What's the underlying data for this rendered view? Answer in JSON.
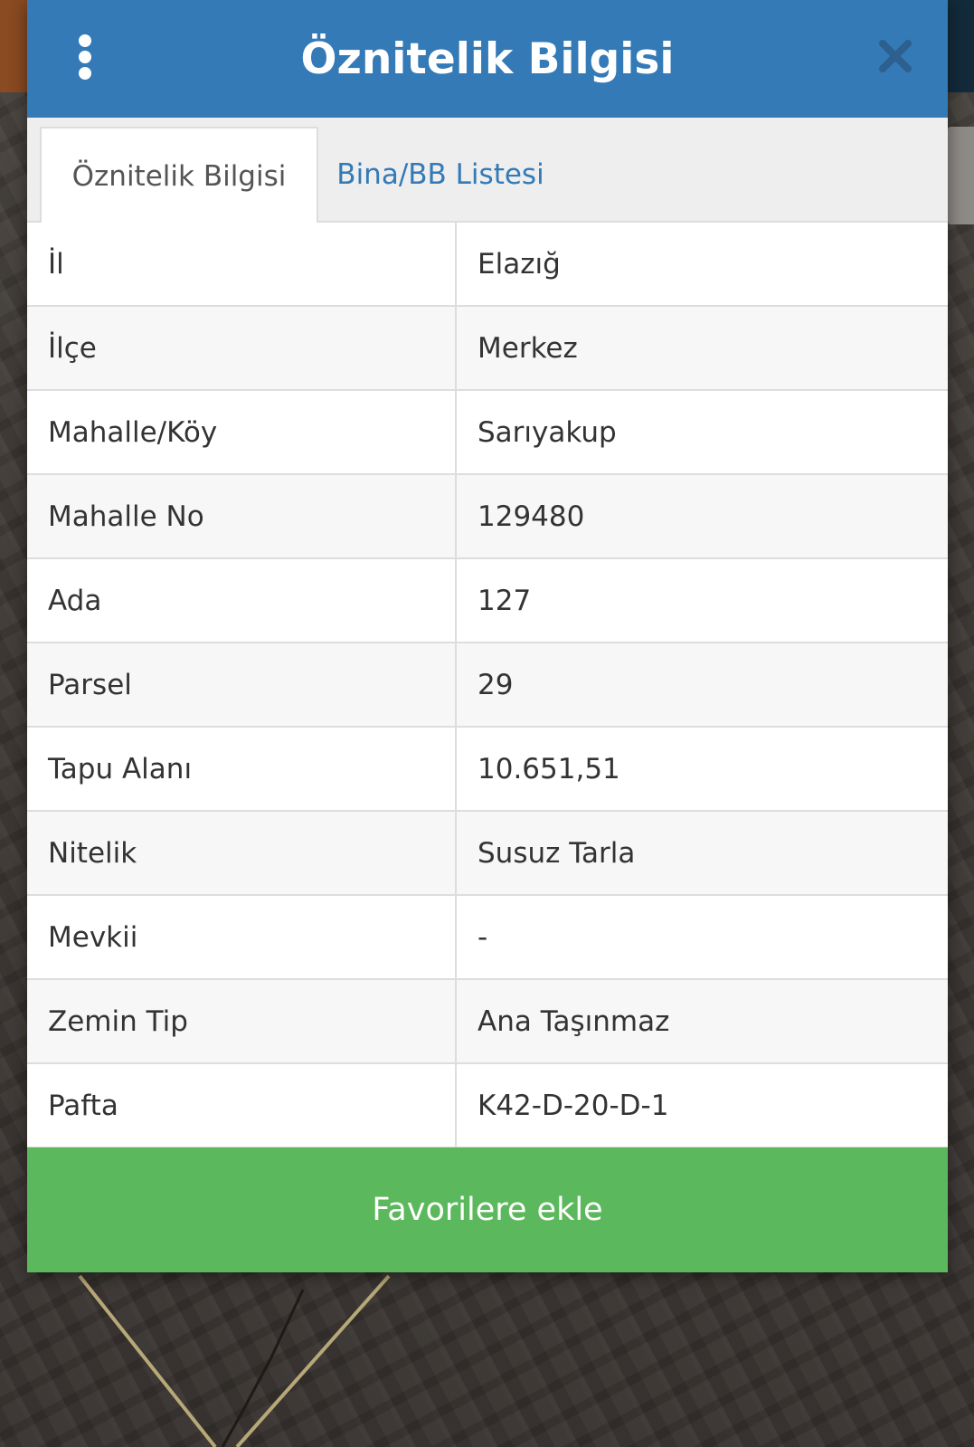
{
  "dialog": {
    "title": "Öznitelik Bilgisi",
    "menu_icon": "kebab-menu-icon",
    "close_icon": "close-icon",
    "header_color": "#337ab7"
  },
  "tabs": [
    {
      "label": "Öznitelik Bilgisi",
      "active": true
    },
    {
      "label": "Bina/BB Listesi",
      "active": false
    }
  ],
  "attributes": [
    {
      "label": "İl",
      "value": "Elazığ"
    },
    {
      "label": "İlçe",
      "value": "Merkez"
    },
    {
      "label": "Mahalle/Köy",
      "value": "Sarıyakup"
    },
    {
      "label": "Mahalle No",
      "value": "129480"
    },
    {
      "label": "Ada",
      "value": "127"
    },
    {
      "label": "Parsel",
      "value": "29"
    },
    {
      "label": "Tapu Alanı",
      "value": "10.651,51"
    },
    {
      "label": "Nitelik",
      "value": "Susuz Tarla"
    },
    {
      "label": "Mevkii",
      "value": "-"
    },
    {
      "label": "Zemin Tip",
      "value": "Ana Taşınmaz"
    },
    {
      "label": "Pafta",
      "value": "K42-D-20-D-1"
    }
  ],
  "actions": {
    "favorite_label": "Favorilere ekle",
    "favorite_color": "#5cb85c"
  }
}
